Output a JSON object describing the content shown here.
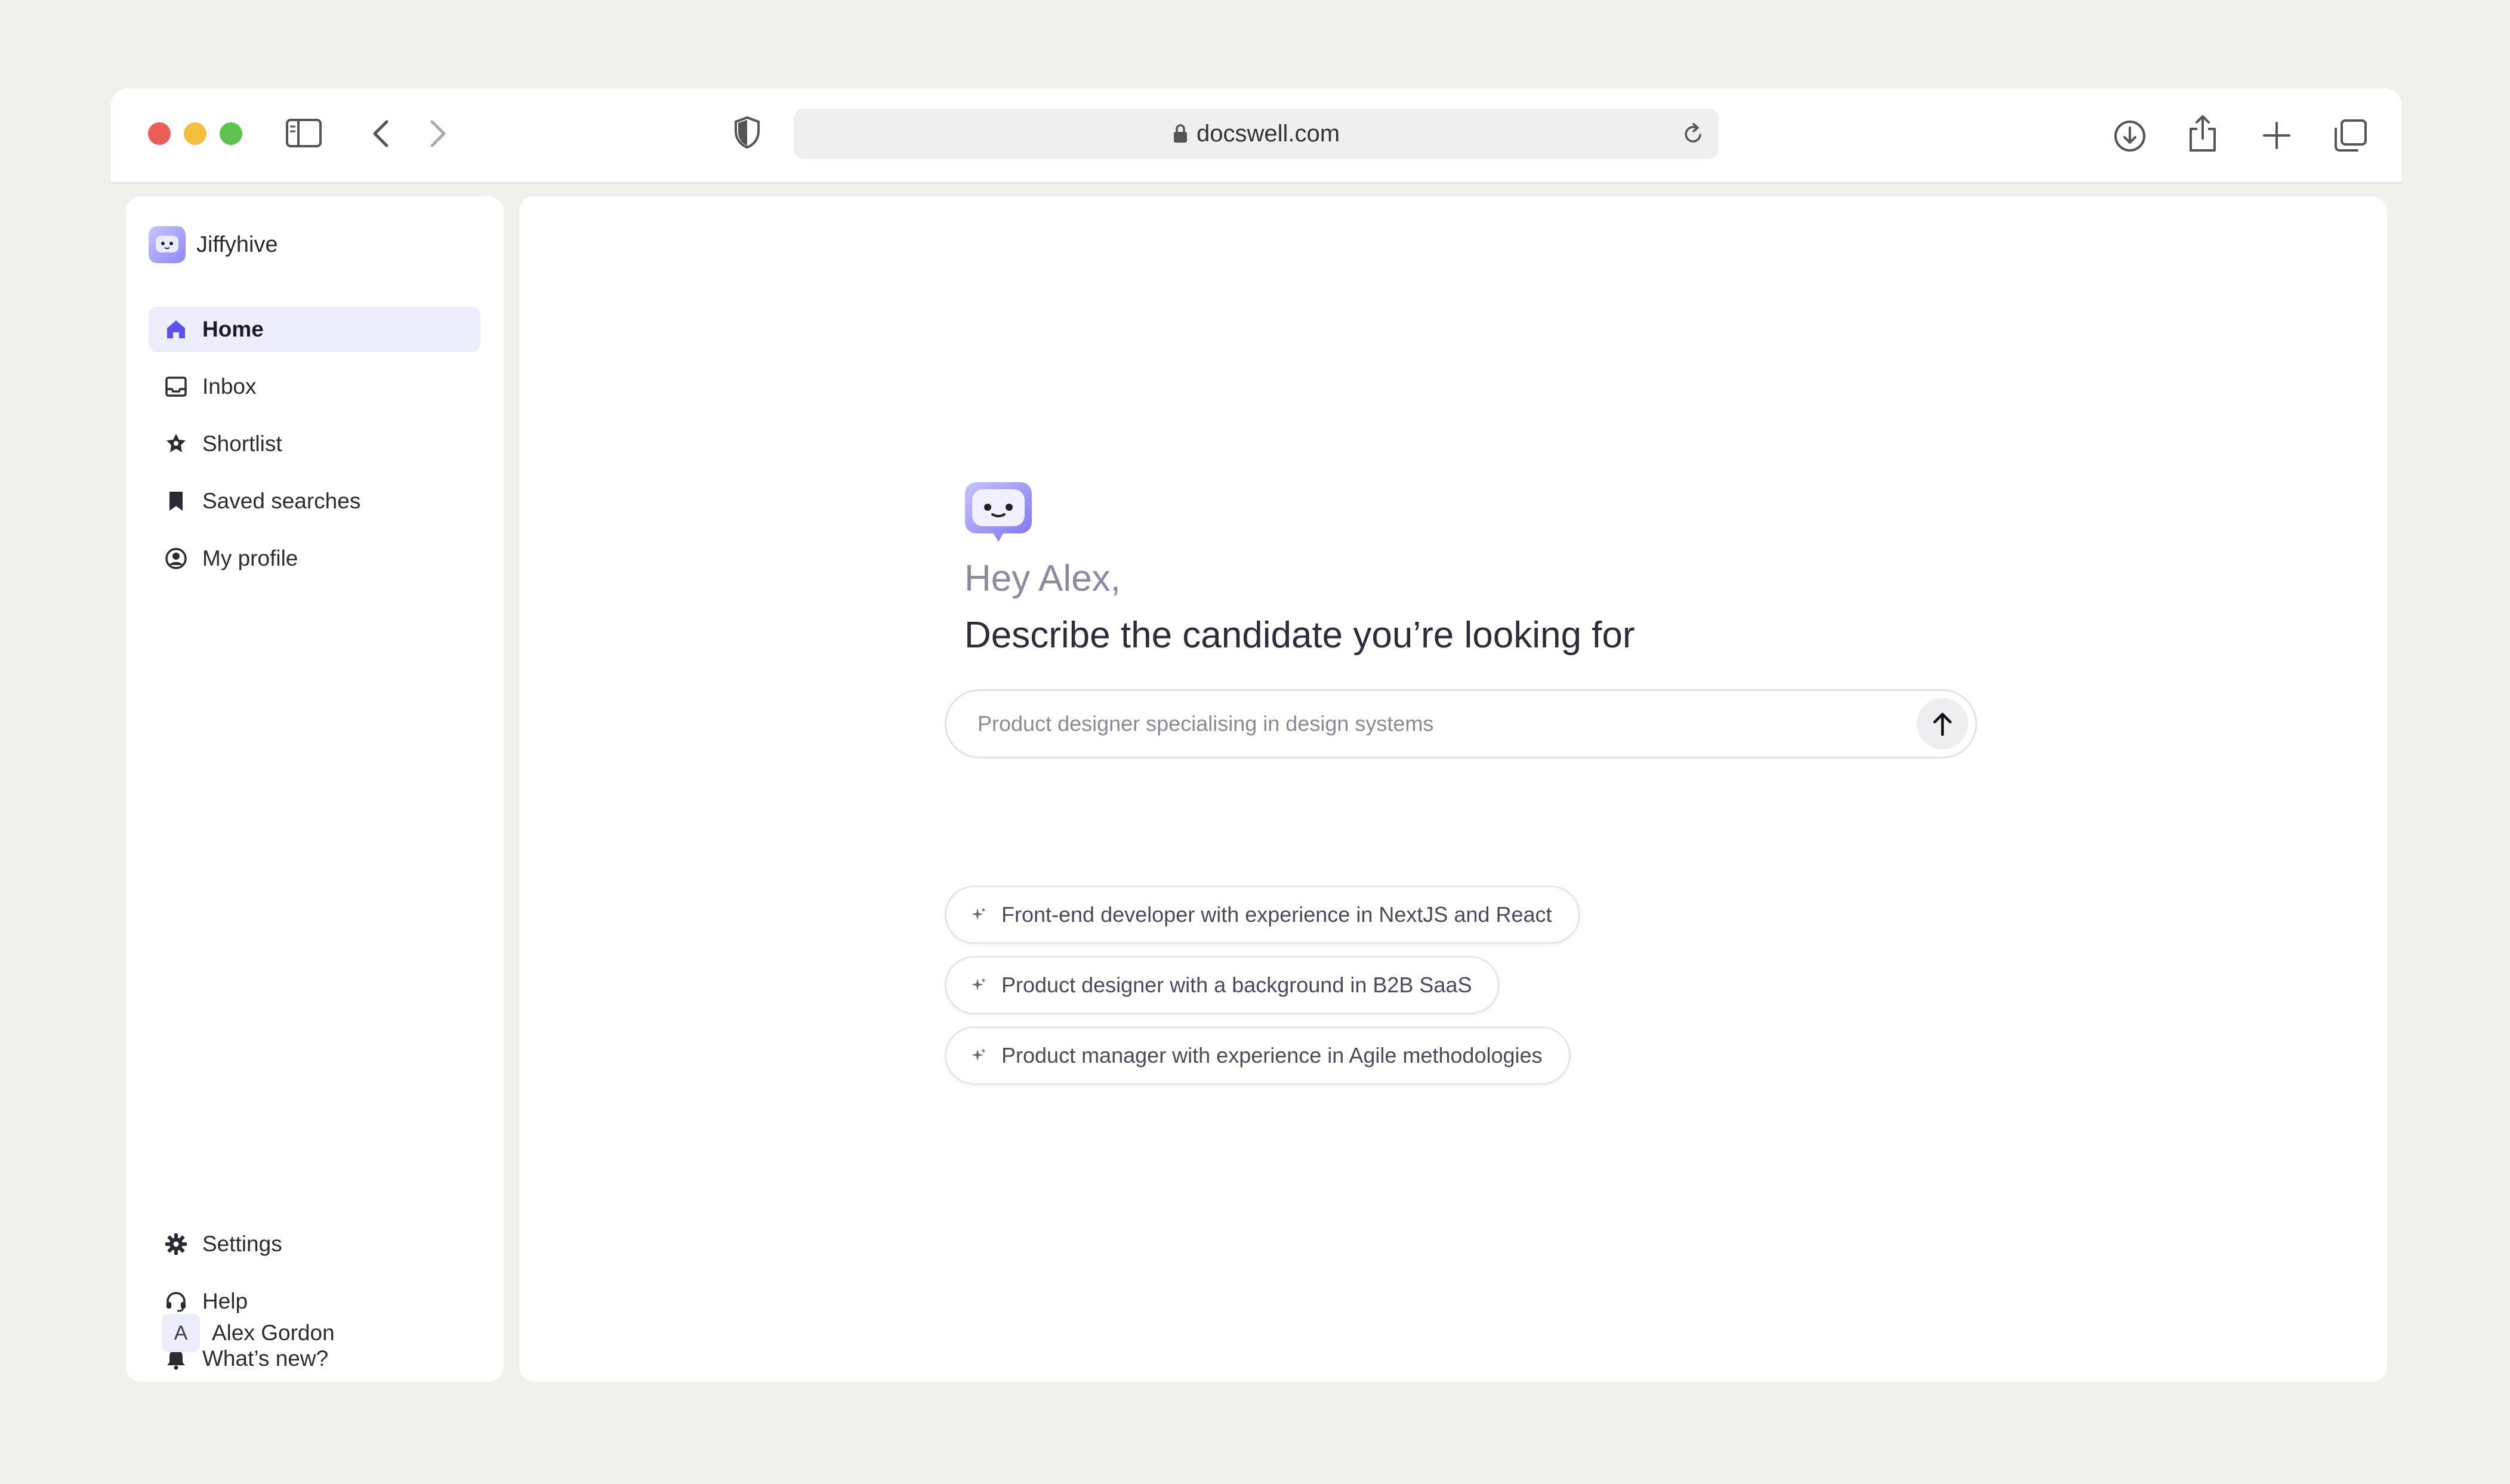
{
  "browser": {
    "url": "docswell.com"
  },
  "sidebar": {
    "brand": "Jiffyhive",
    "items": [
      {
        "label": "Home",
        "icon": "home-icon",
        "active": true
      },
      {
        "label": "Inbox",
        "icon": "inbox-icon",
        "active": false
      },
      {
        "label": "Shortlist",
        "icon": "shortlist-icon",
        "active": false
      },
      {
        "label": "Saved searches",
        "icon": "bookmark-icon",
        "active": false
      },
      {
        "label": "My profile",
        "icon": "profile-icon",
        "active": false
      }
    ],
    "bottom_items": [
      {
        "label": "Settings",
        "icon": "gear-icon"
      },
      {
        "label": "Help",
        "icon": "headset-icon"
      },
      {
        "label": "What’s new?",
        "icon": "bell-icon"
      }
    ],
    "user": {
      "initial": "A",
      "name": "Alex Gordon"
    }
  },
  "main": {
    "greeting": "Hey Alex,",
    "headline": "Describe the candidate you’re looking for",
    "search": {
      "placeholder": "Product designer specialising in design systems",
      "value": ""
    },
    "suggestions": [
      "Front-end developer with experience in NextJS and React",
      "Product designer with a background in B2B SaaS",
      "Product manager with experience in Agile methodologies"
    ]
  },
  "colors": {
    "accent": "#5b52e8",
    "active_nav_bg": "#eeedfc",
    "page_bg": "#f0f0ed"
  }
}
